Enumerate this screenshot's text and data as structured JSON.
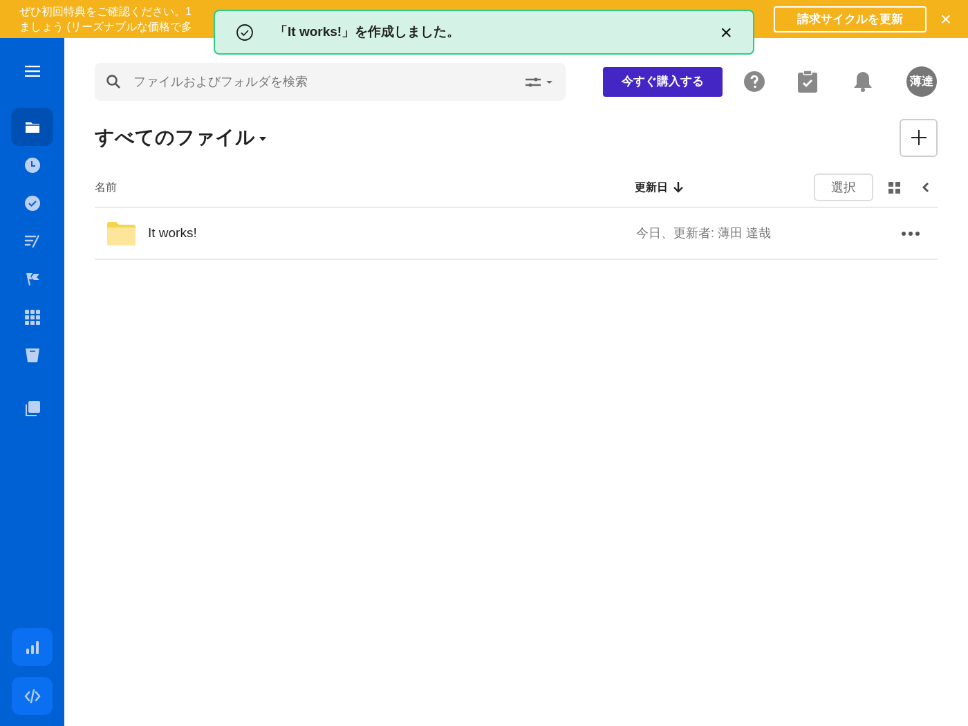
{
  "banner": {
    "lines": [
      "ぜひ初回特典をご確認ください。1",
      "ましょう (リーズナブルな価格で多"
    ],
    "button": "請求サイクルを更新",
    "close": "×"
  },
  "toast": {
    "message": "「It works!」を作成しました。",
    "close": "×"
  },
  "sidebar": {
    "items": [
      {
        "kind": "folder",
        "selected": true
      },
      {
        "kind": "clock",
        "selected": false
      },
      {
        "kind": "check",
        "selected": false
      },
      {
        "kind": "sign",
        "selected": false
      },
      {
        "kind": "flag",
        "selected": false
      },
      {
        "kind": "grid",
        "selected": false
      },
      {
        "kind": "trash",
        "selected": false
      },
      {
        "kind": "copy",
        "selected": false
      }
    ],
    "bottom": [
      {
        "kind": "chart"
      },
      {
        "kind": "code"
      }
    ]
  },
  "search": {
    "placeholder": "ファイルおよびフォルダを検索"
  },
  "buy_button": "今すぐ購入する",
  "avatar": "薄達",
  "title": "すべてのファイル",
  "table": {
    "columns": [
      "名前",
      "更新日"
    ],
    "select_button": "選択",
    "rows": [
      {
        "name": "It works!",
        "modified": "今日、更新者: 薄田 達哉"
      }
    ]
  }
}
